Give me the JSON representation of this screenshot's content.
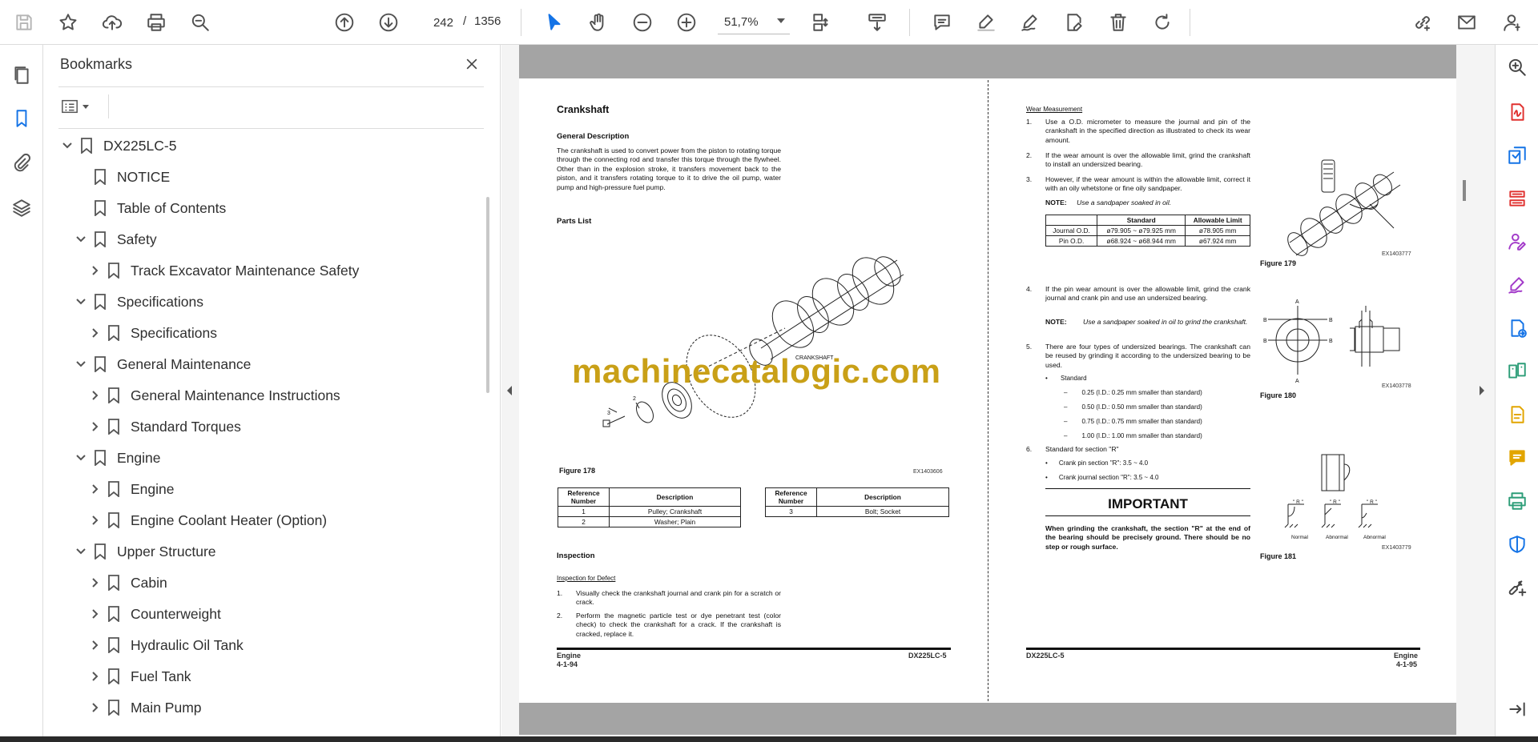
{
  "toolbar": {
    "page_current": "242",
    "page_sep": "/",
    "page_total": "1356",
    "zoom": "51,7%"
  },
  "bookmarks": {
    "title": "Bookmarks",
    "items": [
      {
        "label": "DX225LC-5",
        "level": 0,
        "state": "expanded"
      },
      {
        "label": "NOTICE",
        "level": 1,
        "state": "leaf"
      },
      {
        "label": "Table of Contents",
        "level": 1,
        "state": "leaf"
      },
      {
        "label": "Safety",
        "level": 1,
        "state": "expanded"
      },
      {
        "label": "Track Excavator Maintenance Safety",
        "level": 2,
        "state": "collapsed"
      },
      {
        "label": "Specifications",
        "level": 1,
        "state": "expanded"
      },
      {
        "label": "Specifications",
        "level": 2,
        "state": "collapsed"
      },
      {
        "label": "General Maintenance",
        "level": 1,
        "state": "expanded"
      },
      {
        "label": "General Maintenance Instructions",
        "level": 2,
        "state": "collapsed"
      },
      {
        "label": "Standard Torques",
        "level": 2,
        "state": "collapsed"
      },
      {
        "label": "Engine",
        "level": 1,
        "state": "expanded"
      },
      {
        "label": "Engine",
        "level": 2,
        "state": "collapsed"
      },
      {
        "label": "Engine Coolant Heater (Option)",
        "level": 2,
        "state": "collapsed"
      },
      {
        "label": "Upper Structure",
        "level": 1,
        "state": "expanded"
      },
      {
        "label": "Cabin",
        "level": 2,
        "state": "collapsed"
      },
      {
        "label": "Counterweight",
        "level": 2,
        "state": "collapsed"
      },
      {
        "label": "Hydraulic Oil Tank",
        "level": 2,
        "state": "collapsed"
      },
      {
        "label": "Fuel Tank",
        "level": 2,
        "state": "collapsed"
      },
      {
        "label": "Main Pump",
        "level": 2,
        "state": "collapsed"
      }
    ]
  },
  "left_page": {
    "title": "Crankshaft",
    "general_heading": "General Description",
    "general_text": "The crankshaft is used to convert power from the piston to rotating torque through the connecting rod and transfer this torque through the flywheel. Other than in the explosion stroke, it transfers movement back to the piston, and it transfers rotating torque to it to drive the oil pump, water pump and high-pressure fuel pump.",
    "parts_heading": "Parts List",
    "crankshaft_label": "CRANKSHAFT",
    "callout_2": "2",
    "callout_3": "3",
    "figure_label": "Figure 178",
    "figure_code": "EX1403606",
    "table1": {
      "headers": [
        "Reference Number",
        "Description"
      ],
      "rows": [
        [
          "1",
          "Pulley; Crankshaft"
        ],
        [
          "2",
          "Washer; Plain"
        ]
      ]
    },
    "table2": {
      "headers": [
        "Reference Number",
        "Description"
      ],
      "rows": [
        [
          "3",
          "Bolt; Socket"
        ]
      ]
    },
    "inspection_heading": "Inspection",
    "defect_heading": "Inspection for Defect",
    "steps": [
      {
        "n": "1.",
        "text": "Visually check the crankshaft journal and crank pin for a scratch or crack."
      },
      {
        "n": "2.",
        "text": "Perform the magnetic particle test or dye penetrant test (color check) to check the crankshaft for a crack. If the crankshaft is cracked, replace it."
      }
    ],
    "footer_left_1": "Engine",
    "footer_left_2": "4-1-94",
    "footer_right": "DX225LC-5"
  },
  "right_page": {
    "wear_heading": "Wear Measurement",
    "steps": [
      {
        "n": "1.",
        "text": "Use a O.D. micrometer to measure the journal and pin of the crankshaft in the specified direction as illustrated to check its wear amount."
      },
      {
        "n": "2.",
        "text": "If the wear amount is over the allowable limit, grind the crankshaft to install an undersized bearing."
      },
      {
        "n": "3.",
        "text": "However, if the wear amount is within the allowable limit, correct it with an oily whetstone or fine oily sandpaper."
      }
    ],
    "note1_label": "NOTE:",
    "note1_text": "Use a sandpaper soaked in oil.",
    "wear_table": {
      "headers": [
        "",
        "Standard",
        "Allowable Limit"
      ],
      "rows": [
        [
          "Journal O.D.",
          "ø79.905 ~ ø79.925 mm",
          "ø78.905 mm"
        ],
        [
          "Pin O.D.",
          "ø68.924 ~ ø68.944 mm",
          "ø67.924 mm"
        ]
      ]
    },
    "step4": {
      "n": "4.",
      "text": "If the pin wear amount is over the allowable limit, grind the crank journal and crank pin and use an undersized bearing."
    },
    "note2_label": "NOTE:",
    "note2_text": "Use a sandpaper soaked in oil to grind the crankshaft.",
    "step5": {
      "n": "5.",
      "text": "There are four types of undersized bearings. The crankshaft can be reused by grinding it according to the undersized bearing to be used."
    },
    "bullet_standard": "Standard",
    "dash_items": [
      "0.25 (I.D.: 0.25 mm smaller than standard)",
      "0.50 (I.D.: 0.50 mm smaller than standard)",
      "0.75 (I.D.: 0.75 mm smaller than standard)",
      "1.00 (I.D.: 1.00 mm smaller than standard)"
    ],
    "step6": {
      "n": "6.",
      "text": "Standard for section \"R\""
    },
    "bullets6": [
      "Crank pin section \"R\": 3.5 ~ 4.0",
      "Crank journal section \"R\": 3.5 ~ 4.0"
    ],
    "important_title": "IMPORTANT",
    "important_text": "When grinding the crankshaft, the section \"R\" at the end of the bearing should be precisely ground. There should be no step or rough surface.",
    "fig179": "Figure 179",
    "fig179_code": "EX1403777",
    "fig180": "Figure 180",
    "fig180_code": "EX1403778",
    "fig181": "Figure 181",
    "fig181_code": "EX1403779",
    "fig180_a": "A",
    "fig180_b": "B",
    "fig181_r": "\" R \"",
    "fig181_labels": [
      "Normal",
      "Abnormal",
      "Abnormal"
    ],
    "footer_left": "DX225LC-5",
    "footer_right_1": "Engine",
    "footer_right_2": "4-1-95"
  },
  "watermark": "machinecatalogic.com",
  "colors": {
    "accent_blue": "#1473e6",
    "rail_red": "#e0312f",
    "rail_purple": "#a23ac9",
    "rail_green": "#2d9d78",
    "rail_yellow": "#e2a500",
    "watermark": "#c9a017"
  }
}
